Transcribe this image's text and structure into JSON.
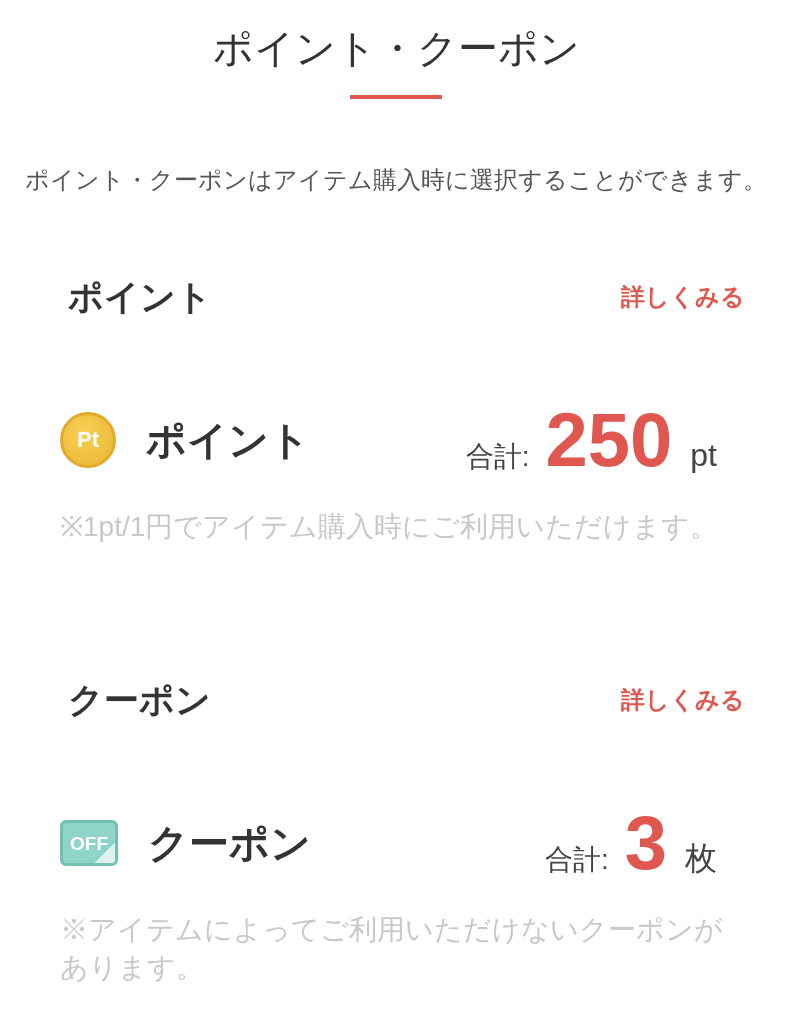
{
  "title": "ポイント・クーポン",
  "description": "ポイント・クーポンはアイテム購入時に選択することができます。",
  "sections": [
    {
      "kind": "point",
      "heading": "ポイント",
      "link": "詳しくみる",
      "icon_text": "Pt",
      "label": "ポイント",
      "total_label": "合計:",
      "total": "250",
      "unit": "pt",
      "note": "※1pt/1円でアイテム購入時にご利用いただけます。"
    },
    {
      "kind": "coupon",
      "heading": "クーポン",
      "link": "詳しくみる",
      "icon_text": "OFF",
      "label": "クーポン",
      "total_label": "合計:",
      "total": "3",
      "unit": "枚",
      "note": "※アイテムによってご利用いただけないクーポンがあります。"
    }
  ]
}
